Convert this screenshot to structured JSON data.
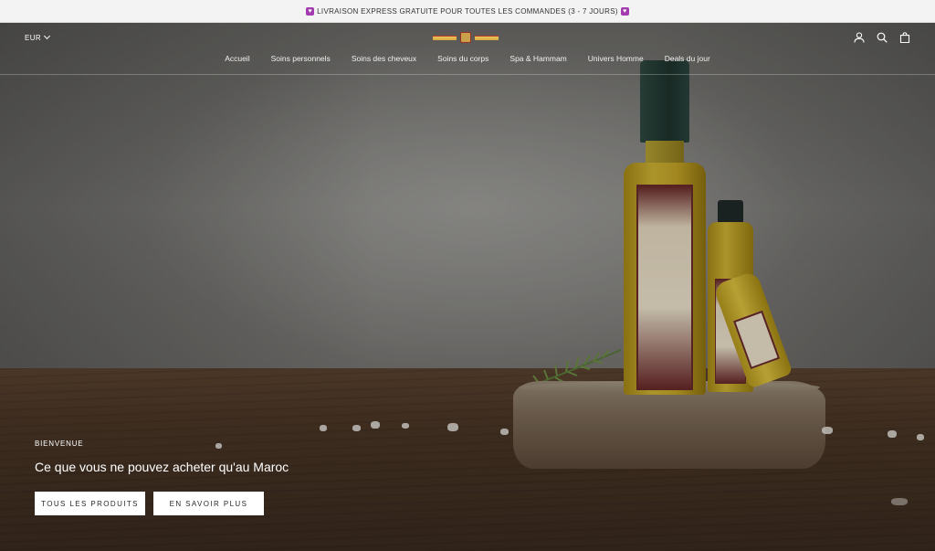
{
  "announcement": {
    "text": "LIVRAISON EXPRESS GRATUITE POUR TOUTES LES COMMANDES (3 - 7 JOURS)",
    "heart_left": "♥",
    "heart_right": "♥"
  },
  "header": {
    "currency": "EUR",
    "icons": [
      "account-icon",
      "search-icon",
      "cart-icon"
    ]
  },
  "nav": {
    "items": [
      "Accueil",
      "Soins personnels",
      "Soins des cheveux",
      "Soins du corps",
      "Spa & Hammam",
      "Univers Homme",
      "Deals du jour"
    ]
  },
  "hero": {
    "kicker": "BIENVENUE",
    "headline": "Ce que vous ne pouvez acheter qu'au Maroc",
    "buttons": [
      "TOUS LES PRODUITS",
      "EN SAVOIR PLUS"
    ]
  }
}
